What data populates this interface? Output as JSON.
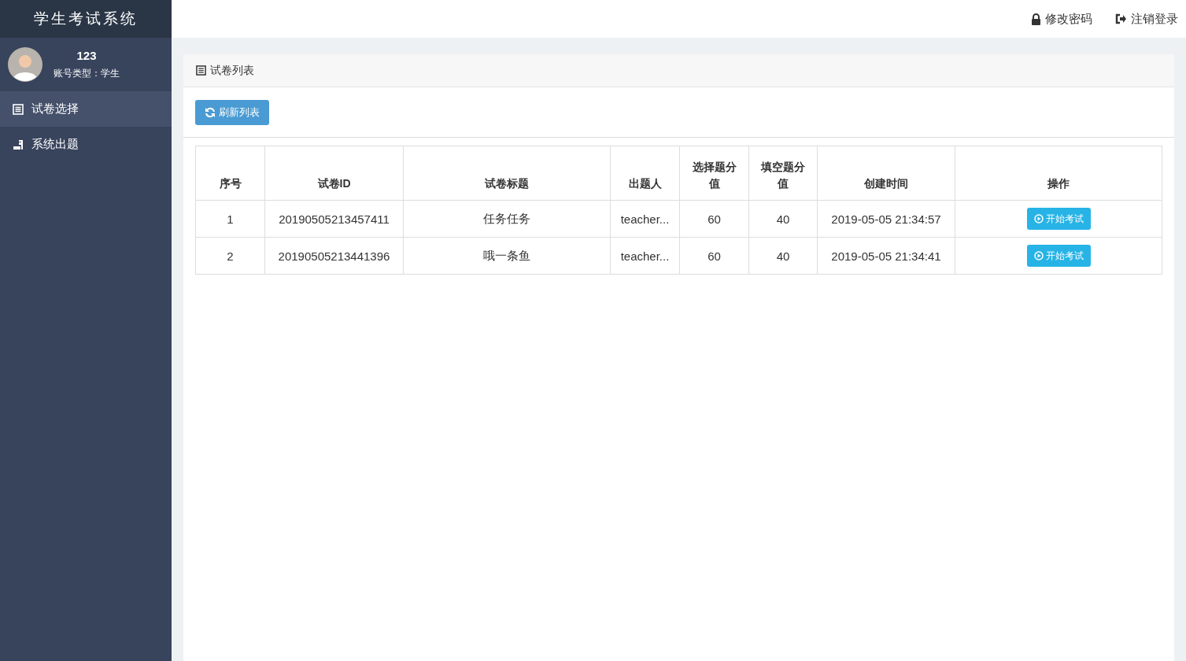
{
  "app": {
    "title": "学生考试系统"
  },
  "user": {
    "name": "123",
    "account_type": "账号类型：学生"
  },
  "sidebar": {
    "items": [
      {
        "label": "试卷选择",
        "kind": "list",
        "selected": true
      },
      {
        "label": "系统出题",
        "kind": "edit",
        "selected": false
      }
    ]
  },
  "topbar": {
    "links": [
      {
        "label": "修改密码",
        "kind": "lock"
      },
      {
        "label": "注销登录",
        "kind": "logout"
      }
    ]
  },
  "panel": {
    "title": "试卷列表",
    "refresh_button": "刷新列表"
  },
  "table": {
    "columns": [
      "序号",
      "试卷ID",
      "试卷标题",
      "出题人",
      "选择题分值",
      "填空题分值",
      "创建时间",
      "操作"
    ],
    "rows": [
      {
        "cells": [
          "1",
          "20190505213457411",
          "任务任务",
          "teacher...",
          "60",
          "40",
          "2019-05-05 21:34:57"
        ],
        "action": "开始考试"
      },
      {
        "cells": [
          "2",
          "20190505213441396",
          "哦一条鱼",
          "teacher...",
          "60",
          "40",
          "2019-05-05 21:34:41"
        ],
        "action": "开始考试"
      }
    ]
  }
}
